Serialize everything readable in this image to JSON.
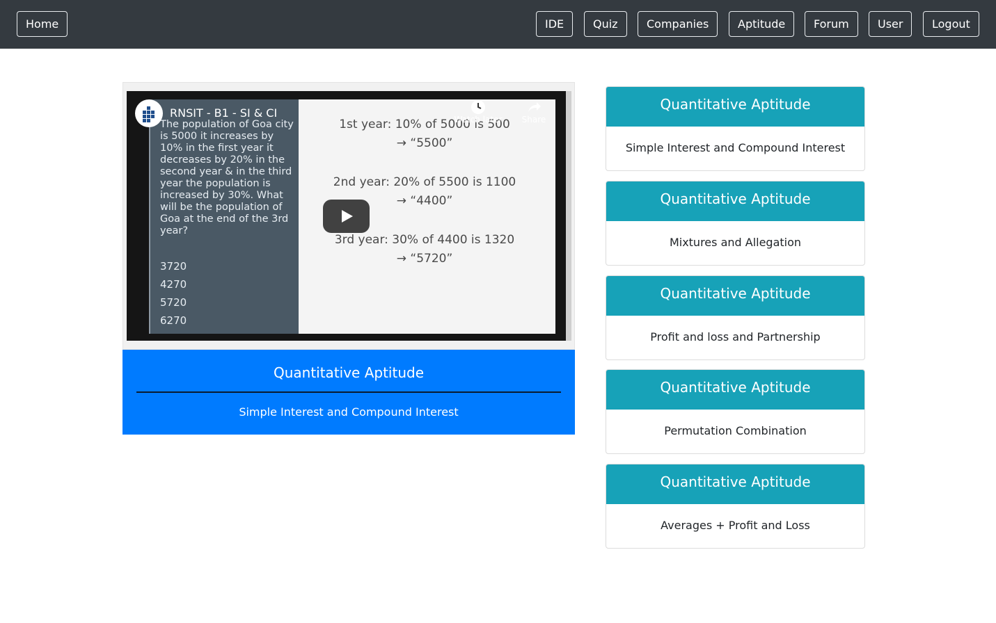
{
  "nav": {
    "home": "Home",
    "ide": "IDE",
    "quiz": "Quiz",
    "companies": "Companies",
    "aptitude": "Aptitude",
    "forum": "Forum",
    "user": "User",
    "logout": "Logout"
  },
  "video": {
    "title": "RNSIT - B1 - SI & CI",
    "watch_later": "Watch later",
    "share": "Share",
    "question": "The population of Goa city is 5000 it increases by 10%  in the first year it decreases by 20% in the second year & in the third year the population is increased by 30%. What will be the population of Goa at the end of the 3rd year?",
    "options": [
      "3720",
      "4270",
      "5720",
      "6270"
    ],
    "steps": [
      {
        "line1": "1st year: 10% of 5000 is 500",
        "line2": "→ “5500”"
      },
      {
        "line1": "2nd year: 20% of 5500 is 1100",
        "line2": "→ “4400”"
      },
      {
        "line1": "3rd year: 30% of 4400 is 1320",
        "line2": "→ “5720”"
      }
    ]
  },
  "caption": {
    "title": "Quantitative Aptitude",
    "subtitle": "Simple Interest and Compound Interest"
  },
  "cards": [
    {
      "title": "Quantitative Aptitude",
      "topic": "Simple Interest and Compound Interest"
    },
    {
      "title": "Quantitative Aptitude",
      "topic": "Mixtures and Allegation"
    },
    {
      "title": "Quantitative Aptitude",
      "topic": "Profit and loss and Partnership"
    },
    {
      "title": "Quantitative Aptitude",
      "topic": "Permutation Combination"
    },
    {
      "title": "Quantitative Aptitude",
      "topic": "Averages + Profit and Loss"
    }
  ],
  "colors": {
    "navbar": "#343a40",
    "caption": "#007bff",
    "card_header": "#17a2b8"
  }
}
